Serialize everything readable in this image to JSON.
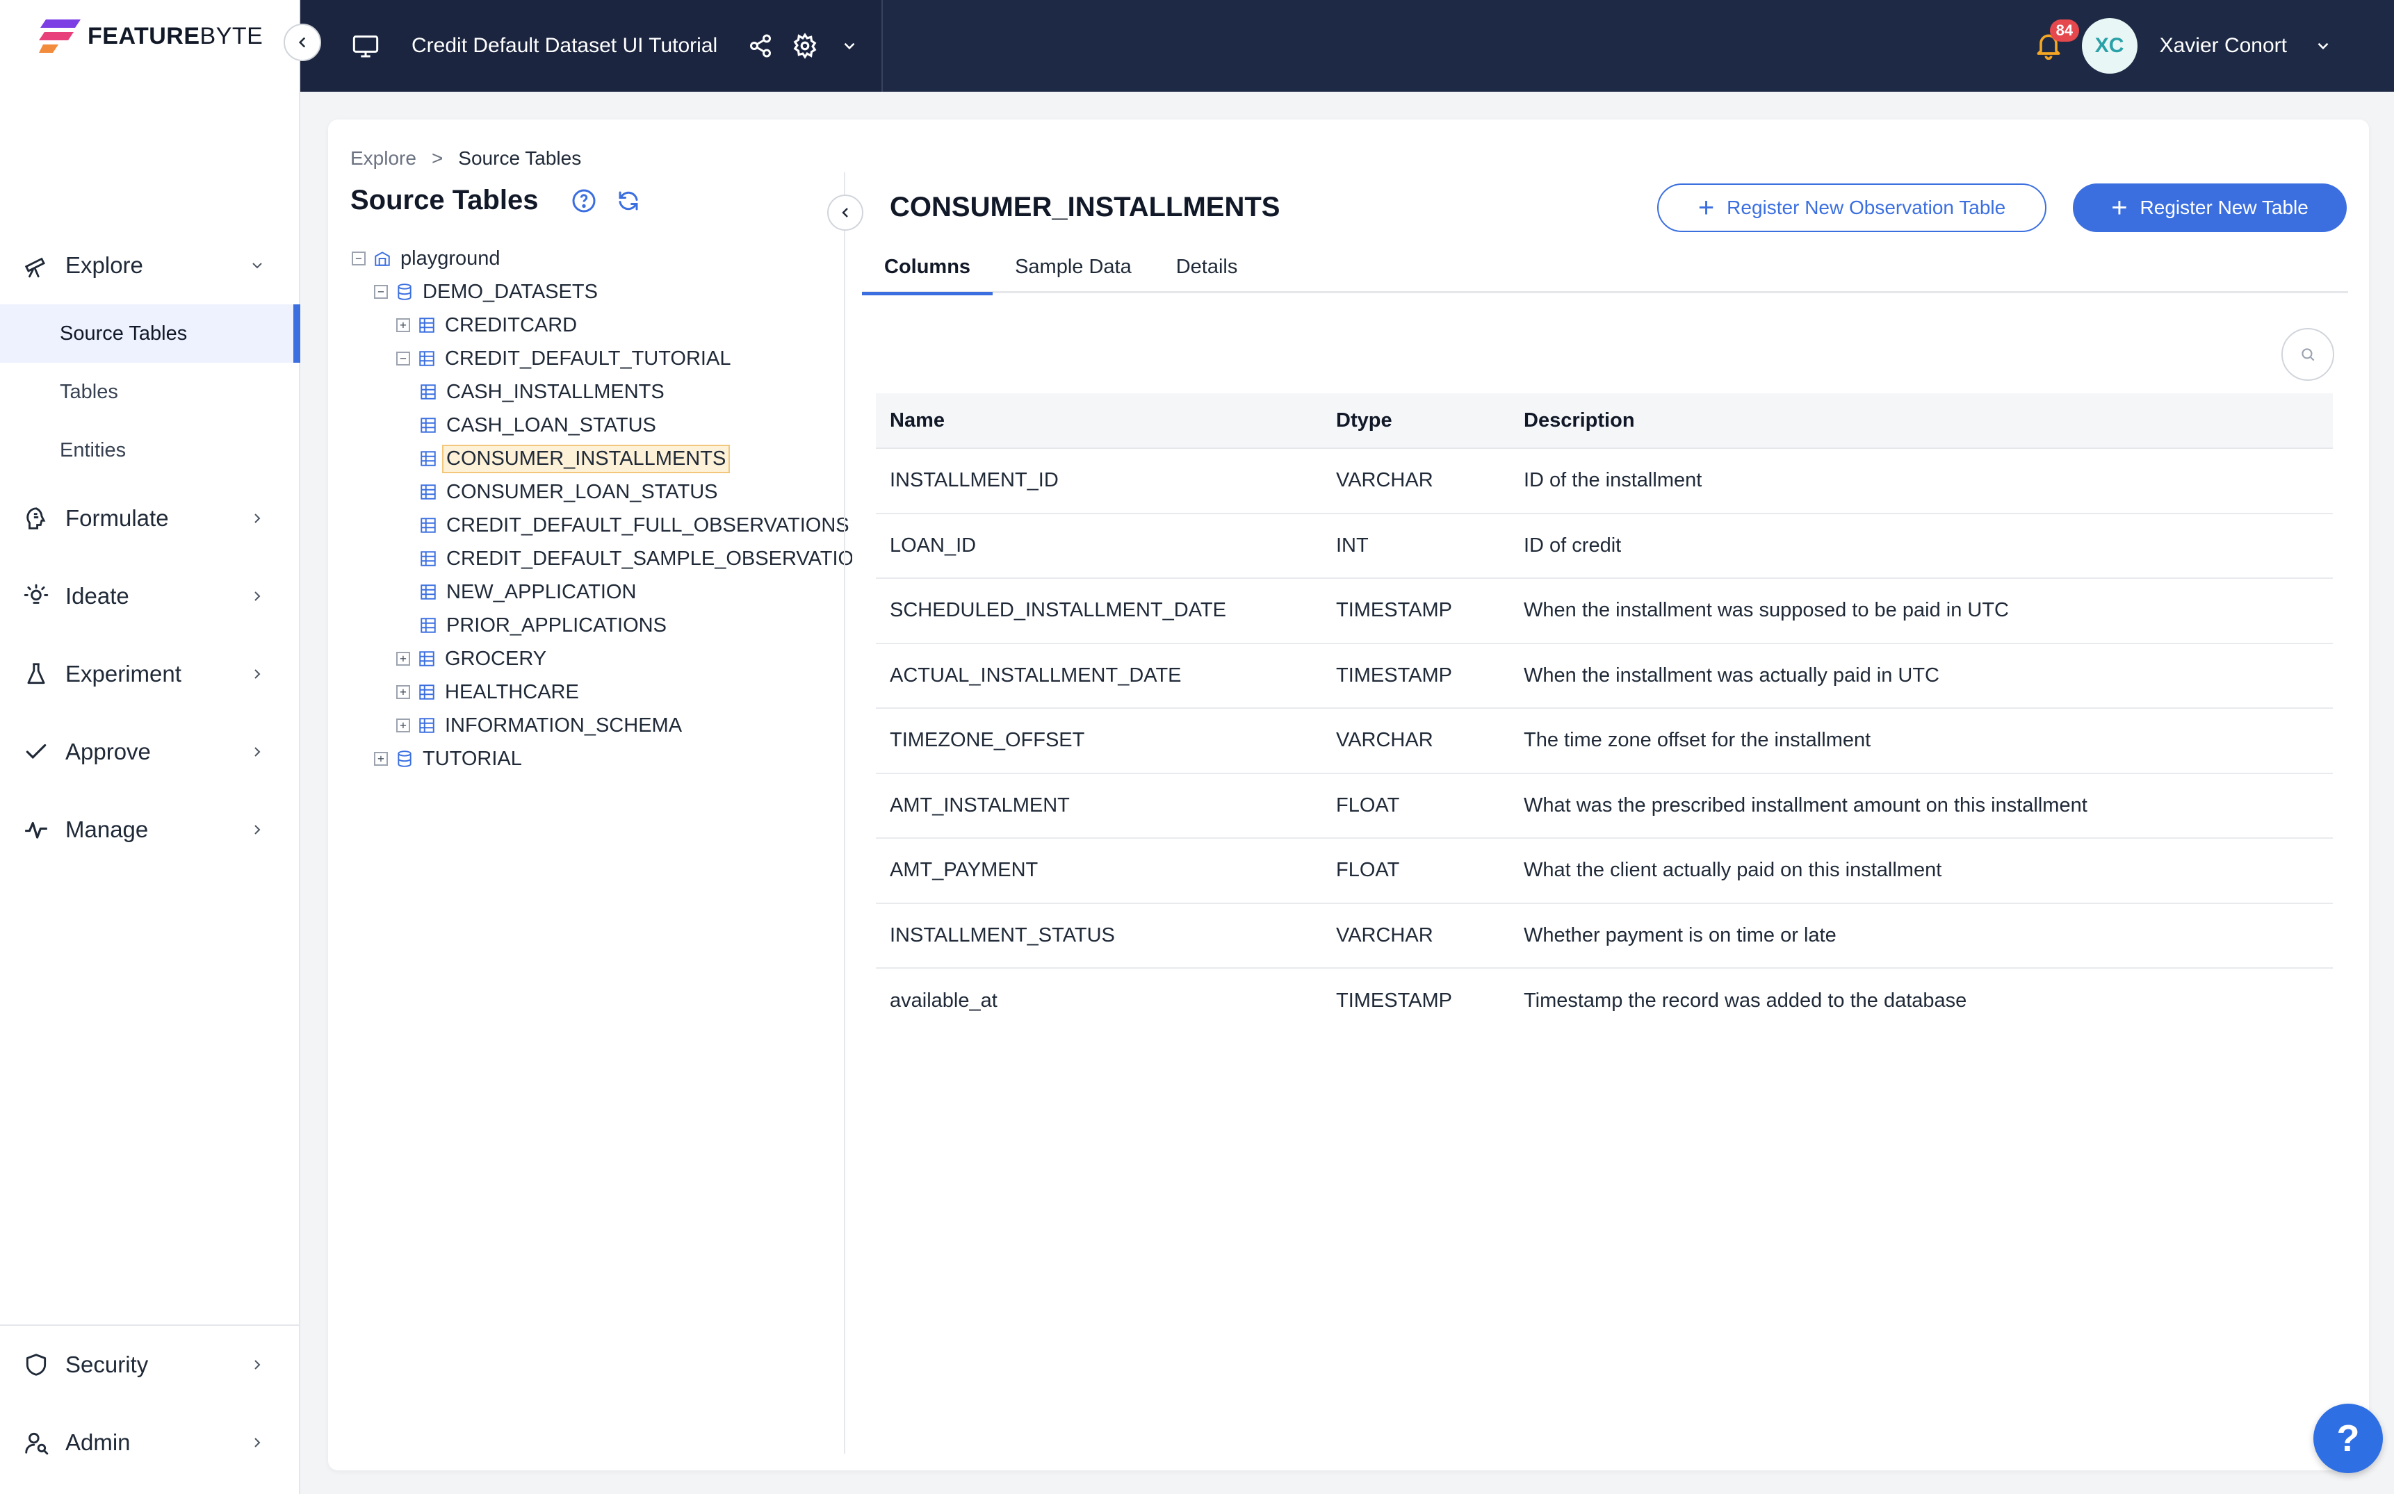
{
  "brand": {
    "name_bold": "FEATURE",
    "name_light": "BYTE"
  },
  "topbar": {
    "project_title": "Credit Default Dataset UI Tutorial",
    "notification_count": "84",
    "user_initials": "XC",
    "user_name": "Xavier Conort"
  },
  "sidebar": {
    "explore": "Explore",
    "explore_items": [
      "Source Tables",
      "Tables",
      "Entities"
    ],
    "formulate": "Formulate",
    "ideate": "Ideate",
    "experiment": "Experiment",
    "approve": "Approve",
    "manage": "Manage",
    "security": "Security",
    "admin": "Admin"
  },
  "breadcrumb": {
    "root": "Explore",
    "separator": ">",
    "current": "Source Tables"
  },
  "panel": {
    "title": "Source Tables"
  },
  "tree": {
    "playground": "playground",
    "demo_datasets": "DEMO_DATASETS",
    "creditcard": "CREDITCARD",
    "credit_default_tutorial": "CREDIT_DEFAULT_TUTORIAL",
    "tables": [
      "CASH_INSTALLMENTS",
      "CASH_LOAN_STATUS",
      "CONSUMER_INSTALLMENTS",
      "CONSUMER_LOAN_STATUS",
      "CREDIT_DEFAULT_FULL_OBSERVATIONS",
      "CREDIT_DEFAULT_SAMPLE_OBSERVATIONS",
      "NEW_APPLICATION",
      "PRIOR_APPLICATIONS"
    ],
    "grocery": "GROCERY",
    "healthcare": "HEALTHCARE",
    "information_schema": "INFORMATION_SCHEMA",
    "tutorial": "TUTORIAL",
    "expanded_symbol": "−",
    "collapsed_symbol": "+"
  },
  "detail": {
    "title": "CONSUMER_INSTALLMENTS",
    "register_observation": "Register New Observation Table",
    "register_table": "Register New Table",
    "tabs": [
      "Columns",
      "Sample Data",
      "Details"
    ],
    "columns_header": {
      "name": "Name",
      "dtype": "Dtype",
      "description": "Description"
    },
    "rows": [
      {
        "name": "INSTALLMENT_ID",
        "dtype": "VARCHAR",
        "description": "ID of the installment"
      },
      {
        "name": "LOAN_ID",
        "dtype": "INT",
        "description": "ID of credit"
      },
      {
        "name": "SCHEDULED_INSTALLMENT_DATE",
        "dtype": "TIMESTAMP",
        "description": "When the installment was supposed to be paid in UTC"
      },
      {
        "name": "ACTUAL_INSTALLMENT_DATE",
        "dtype": "TIMESTAMP",
        "description": "When the installment was actually paid in UTC"
      },
      {
        "name": "TIMEZONE_OFFSET",
        "dtype": "VARCHAR",
        "description": "The time zone offset for the installment"
      },
      {
        "name": "AMT_INSTALMENT",
        "dtype": "FLOAT",
        "description": "What was the prescribed installment amount on this installment"
      },
      {
        "name": "AMT_PAYMENT",
        "dtype": "FLOAT",
        "description": "What the client actually paid on this installment"
      },
      {
        "name": "INSTALLMENT_STATUS",
        "dtype": "VARCHAR",
        "description": "Whether payment is on time or late"
      },
      {
        "name": "available_at",
        "dtype": "TIMESTAMP",
        "description": "Timestamp the record was added to the database"
      }
    ]
  },
  "help": {
    "label": "?"
  },
  "colors": {
    "accent": "#3b6fe0",
    "topbar": "#1e2a45",
    "badge": "#e5484d",
    "selected_bg": "#fdf1d7"
  }
}
